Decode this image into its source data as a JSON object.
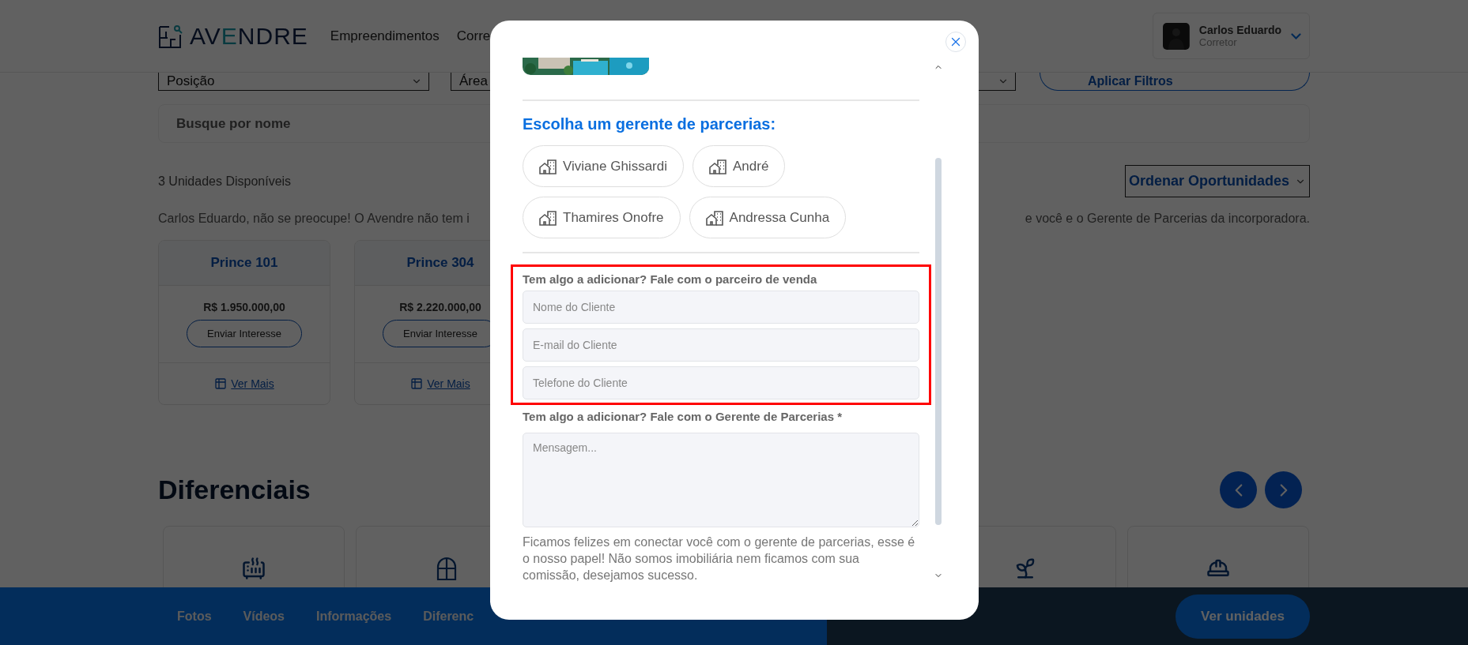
{
  "header": {
    "logo": "AVENDRE",
    "nav": [
      {
        "label": "Empreendimentos"
      },
      {
        "label": "Corre"
      }
    ],
    "user": {
      "name": "Carlos Eduardo",
      "role": "Corretor"
    }
  },
  "filters": {
    "selects": [
      "Posição",
      "Área"
    ],
    "apply_button": "Aplicar Filtros",
    "search": {
      "placeholder": "Busque por nome"
    }
  },
  "units": {
    "count_label": "3 Unidades Disponíveis",
    "sort": {
      "label": "Ordenar Oportunidades"
    },
    "notice_left": "Carlos Eduardo, não se preocupe! O Avendre não tem i",
    "notice_right": "e você e o Gerente de Parcerias da incorporadora.",
    "cards": [
      {
        "title": "Prince 101",
        "price": "R$ 1.950.000,00",
        "button": "Enviar Interesse",
        "link": "Ver Mais"
      },
      {
        "title": "Prince 304",
        "price": "R$ 2.220.000,00",
        "button": "Enviar Interesse",
        "link": "Ver Mais"
      }
    ]
  },
  "features": {
    "title": "Diferenciais",
    "cards_left": [
      {
        "kind": "grill"
      },
      {
        "kind": "window"
      }
    ],
    "cards_right": [
      {
        "kind": "plant"
      },
      {
        "kind": "helmet"
      }
    ]
  },
  "bottom_bar": {
    "tabs": [
      {
        "label": "Fotos"
      },
      {
        "label": "Vídeos"
      },
      {
        "label": "Informações"
      },
      {
        "label": "Diferenc"
      }
    ],
    "cta": "Ver unidades"
  },
  "modal": {
    "heading": "Escolha um gerente de parcerias:",
    "managers": [
      {
        "name": "Viviane Ghissardi"
      },
      {
        "name": "André"
      },
      {
        "name": "Thamires Onofre"
      },
      {
        "name": "Andressa Cunha"
      }
    ],
    "partner_section": {
      "highlighted": true,
      "label": "Tem algo a adicionar? Fale com o parceiro de venda",
      "fields": [
        {
          "placeholder": "Nome do Cliente"
        },
        {
          "placeholder": "E-mail do Cliente"
        },
        {
          "placeholder": "Telefone do Cliente"
        }
      ]
    },
    "message": {
      "label": "Tem algo a adicionar? Fale com o Gerente de Parcerias *",
      "placeholder": "Mensagem..."
    },
    "note": "Ficamos felizes em conectar você com o gerente de parcerias, esse é o nosso papel! Não somos imobiliária nem ficamos com sua comissão, desejamos sucesso."
  }
}
